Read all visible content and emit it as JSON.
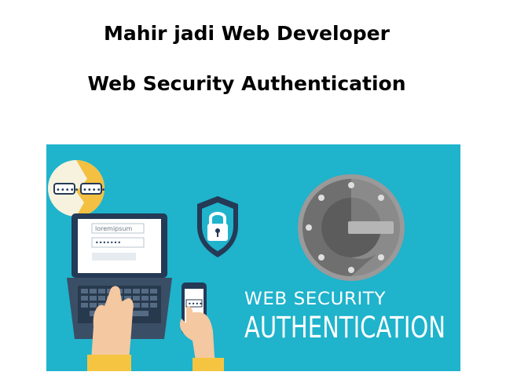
{
  "heading": {
    "line1": "Mahir jadi Web Developer",
    "line2": "Web Security Authentication"
  },
  "banner": {
    "username_field": "loremipsum",
    "password_mask": "•••••••",
    "phone_mask": "••••",
    "bubble_mask_left": "•••••",
    "bubble_mask_right": "•••••",
    "caption_small": "WEB SECURITY",
    "caption_large": "AUTHENTICATION",
    "colors": {
      "background": "#1fb3cc",
      "ink": "#243a56",
      "bubble": "#f4c042",
      "screen": "#ffffff",
      "hand": "#f4c8a0",
      "sleeve": "#f5c542",
      "logo_gray": "#8c8c8c"
    }
  }
}
